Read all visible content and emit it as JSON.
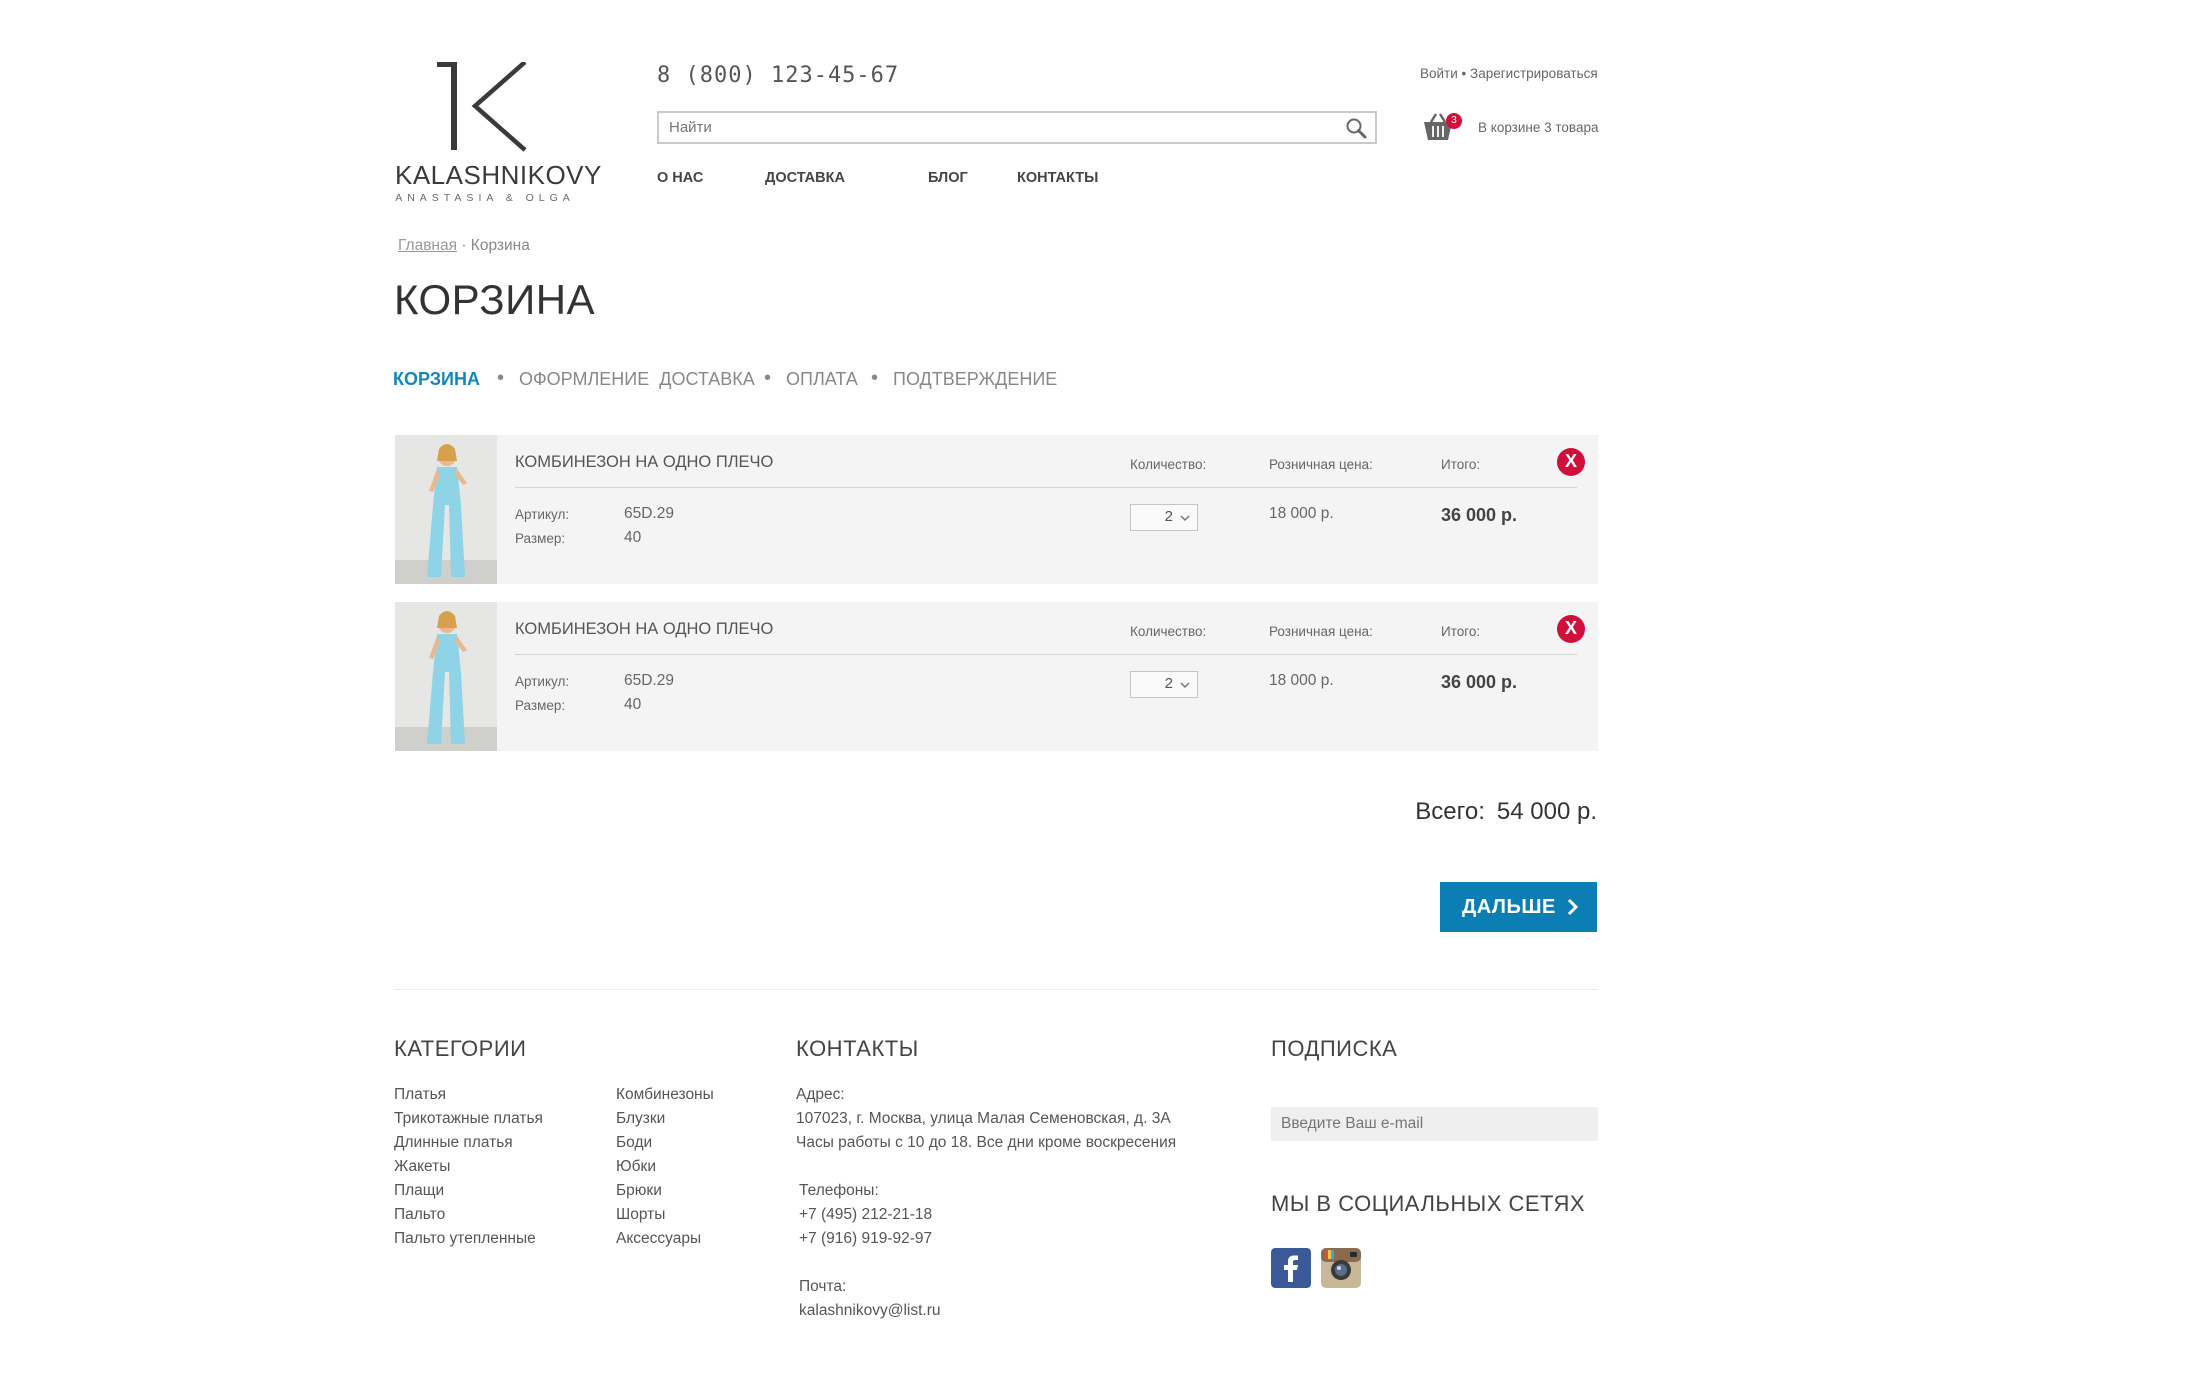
{
  "header": {
    "logo_brand": "KALASHNIKOVY",
    "logo_sub": "ANASTASIA & OLGA",
    "phone": "8 (800) 123-45-67",
    "search_placeholder": "Найти",
    "login": "Войти",
    "separator": "•",
    "register": "Зарегистрироваться",
    "cart_count": "3",
    "cart_text": "В корзине 3 товара",
    "nav": [
      "О НАС",
      "ДОСТАВКА",
      "БЛОГ",
      "КОНТАКТЫ"
    ]
  },
  "breadcrumb": {
    "home": "Главная",
    "sep": "·",
    "current": "Корзина"
  },
  "page_title": "КОРЗИНА",
  "steps": [
    {
      "label": "КОРЗИНА",
      "active": true
    },
    {
      "label": "ОФОРМЛЕНИЕ  ДОСТАВКА",
      "active": false
    },
    {
      "label": "ОПЛАТА",
      "active": false
    },
    {
      "label": "ПОДТВЕРЖДЕНИЕ",
      "active": false
    }
  ],
  "step_dot": "•",
  "cart": {
    "labels": {
      "qty": "Количество:",
      "price": "Розничная цена:",
      "total": "Итого:",
      "article": "Артикул:",
      "size": "Размер:",
      "remove": "X"
    },
    "items": [
      {
        "name": "КОМБИНЕЗОН НА ОДНО ПЛЕЧО",
        "article": "65D.29",
        "size": "40",
        "qty": "2",
        "price": "18 000 р.",
        "total": "36 000 р."
      },
      {
        "name": "КОМБИНЕЗОН НА ОДНО ПЛЕЧО",
        "article": "65D.29",
        "size": "40",
        "qty": "2",
        "price": "18 000 р.",
        "total": "36 000 р."
      }
    ],
    "grand_label": "Всего:",
    "grand_total": "54 000 р.",
    "next_button": "ДАЛЬШЕ"
  },
  "footer": {
    "categories_title": "КАТЕГОРИИ",
    "categories_col1": [
      "Платья",
      "Трикотажные платья",
      "Длинные платья",
      "Жакеты",
      "Плащи",
      "Пальто",
      "Пальто утепленные"
    ],
    "categories_col2": [
      "Комбинезоны",
      "Блузки",
      "Боди",
      "Юбки",
      "Брюки",
      "Шорты",
      "Аксессуары"
    ],
    "contacts_title": "КОНТАКТЫ",
    "address_label": "Адрес:",
    "address": "107023, г. Москва, улица Малая Семеновская, д. 3А",
    "hours": "Часы работы с 10 до 18. Все дни кроме воскресения",
    "phones_label": "Телефоны:",
    "phone1": "+7 (495) 212-21-18",
    "phone2": "+7 (916) 919-92-97",
    "email_label": "Почта:",
    "email": "kalashnikovy@list.ru",
    "subscribe_title": "ПОДПИСКА",
    "subscribe_placeholder": "Введите Ваш e-mail",
    "social_title": "МЫ В СОЦИАЛЬНЫХ СЕТЯХ",
    "social_icons": [
      "facebook-icon",
      "instagram-icon"
    ]
  },
  "colors": {
    "accent": "#0b7fb3",
    "remove": "#d0103a",
    "row_bg": "#f4f4f4"
  }
}
